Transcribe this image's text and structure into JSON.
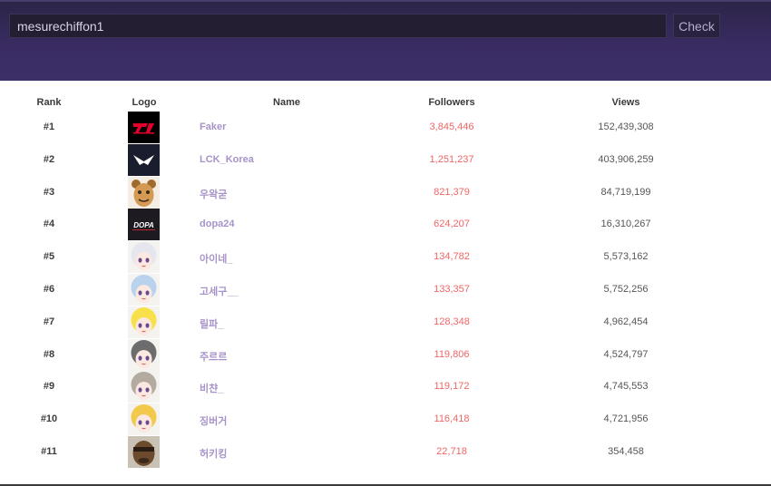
{
  "search": {
    "value": "mesurechiffon1",
    "button_label": "Check"
  },
  "columns": {
    "rank": "Rank",
    "logo": "Logo",
    "name": "Name",
    "followers": "Followers",
    "views": "Views"
  },
  "rows": [
    {
      "rank": "#1",
      "name": "Faker",
      "followers": "3,845,446",
      "views": "152,439,308",
      "logo_icon": "t1-logo-icon",
      "logo_color": "#000000"
    },
    {
      "rank": "#2",
      "name": "LCK_Korea",
      "followers": "1,251,237",
      "views": "403,906,259",
      "logo_icon": "lck-logo-icon",
      "logo_color": "#1a1d2e"
    },
    {
      "rank": "#3",
      "name": "우왁굳",
      "followers": "821,379",
      "views": "84,719,199",
      "logo_icon": "cartoon-face-avatar-icon",
      "logo_color": "#c98a3e"
    },
    {
      "rank": "#4",
      "name": "dopa24",
      "followers": "624,207",
      "views": "16,310,267",
      "logo_icon": "dopa-logo-icon",
      "logo_color": "#1d1a22"
    },
    {
      "rank": "#5",
      "name": "아이네_",
      "followers": "134,782",
      "views": "5,573,162",
      "logo_icon": "anime-avatar-icon",
      "logo_color": "#e6e6ee"
    },
    {
      "rank": "#6",
      "name": "고세구__",
      "followers": "133,357",
      "views": "5,752,256",
      "logo_icon": "anime-avatar-icon",
      "logo_color": "#b9d3ee"
    },
    {
      "rank": "#7",
      "name": "릴파_",
      "followers": "128,348",
      "views": "4,962,454",
      "logo_icon": "anime-avatar-icon",
      "logo_color": "#f7e04a"
    },
    {
      "rank": "#8",
      "name": "주르르",
      "followers": "119,806",
      "views": "4,524,797",
      "logo_icon": "anime-avatar-icon",
      "logo_color": "#6c6c6c"
    },
    {
      "rank": "#9",
      "name": "비챤_",
      "followers": "119,172",
      "views": "4,745,553",
      "logo_icon": "anime-avatar-icon",
      "logo_color": "#b3aba0"
    },
    {
      "rank": "#10",
      "name": "징버거",
      "followers": "116,418",
      "views": "4,721,956",
      "logo_icon": "anime-avatar-icon",
      "logo_color": "#f3c94b"
    },
    {
      "rank": "#11",
      "name": "허키킹",
      "followers": "22,718",
      "views": "354,458",
      "logo_icon": "photo-avatar-icon",
      "logo_color": "#7a5a3a"
    }
  ]
}
